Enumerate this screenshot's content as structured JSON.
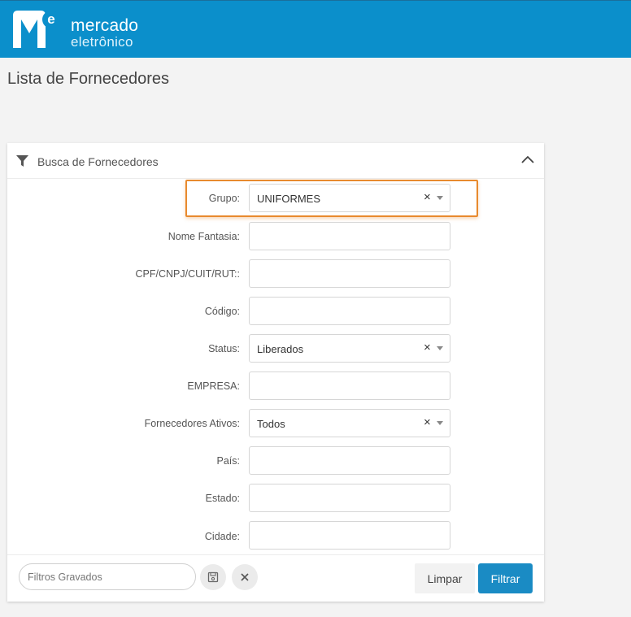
{
  "brand": {
    "name_line1": "mercado",
    "name_line2": "eletrônico",
    "logo_letter": "e",
    "color_primary": "#0b8fcb"
  },
  "page": {
    "title": "Lista de Fornecedores"
  },
  "panel": {
    "title": "Busca de Fornecedores",
    "filter_icon": "filter-icon",
    "collapse_icon": "chevron-up-icon",
    "fields": {
      "grupo": {
        "label": "Grupo:",
        "value": "UNIFORMES",
        "clear": "×"
      },
      "nome_fantasia": {
        "label": "Nome Fantasia:",
        "value": ""
      },
      "cpf": {
        "label": "CPF/CNPJ/CUIT/RUT::",
        "value": ""
      },
      "codigo": {
        "label": "Código:",
        "value": ""
      },
      "status": {
        "label": "Status:",
        "value": "Liberados",
        "clear": "×"
      },
      "empresa": {
        "label": "EMPRESA:",
        "value": ""
      },
      "ativos": {
        "label": "Fornecedores Ativos:",
        "value": "Todos",
        "clear": "×"
      },
      "pais": {
        "label": "País:",
        "value": ""
      },
      "estado": {
        "label": "Estado:",
        "value": ""
      },
      "cidade": {
        "label": "Cidade:",
        "value": ""
      }
    },
    "highlight_color": "#e88a2e",
    "footer": {
      "saved_filters_placeholder": "Filtros Gravados",
      "save_icon": "floppy-disk-icon",
      "clear_icon": "close-icon",
      "clear_label": "Limpar",
      "filter_label": "Filtrar",
      "filter_color": "#1a8bc4"
    }
  }
}
